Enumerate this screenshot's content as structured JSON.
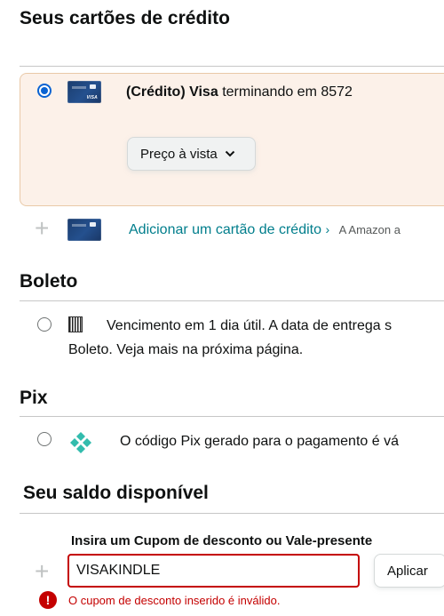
{
  "credit_cards": {
    "heading": "Seus cartões de crédito",
    "card": {
      "type_label": "(Crédito) Visa",
      "ending_text": "terminando em 8572",
      "card_brand_logo": "VISA",
      "payment_option": "Preço à vista",
      "selected": true
    },
    "add_card": {
      "link_text": "Adicionar um cartão de crédito",
      "link_chevron": "›",
      "aside_text": "A Amazon a"
    }
  },
  "boleto": {
    "heading": "Boleto",
    "line1": "Vencimento em 1 dia útil. A data de entrega s",
    "line2": "Boleto. Veja mais na próxima página."
  },
  "pix": {
    "heading": "Pix",
    "description": "O código Pix gerado para o pagamento é vá"
  },
  "balance": {
    "heading": "Seu saldo disponível",
    "coupon_label": "Insira um Cupom de desconto ou Vale-presente",
    "coupon_value": "VISAKINDLE",
    "apply_label": "Aplicar",
    "error_symbol": "!",
    "error_message": "O cupom de desconto inserido é inválido."
  },
  "icons": {
    "dropdown": "chevron-down-icon",
    "add": "plus-icon",
    "boleto": "barcode-icon",
    "pix": "pix-icon",
    "error": "error-icon"
  },
  "colors": {
    "selected_card_bg": "#fcf1e9",
    "link": "#017e8c",
    "radio_selected": "#0a63d2",
    "pix_brand": "#32bcad",
    "error": "#c40000"
  }
}
